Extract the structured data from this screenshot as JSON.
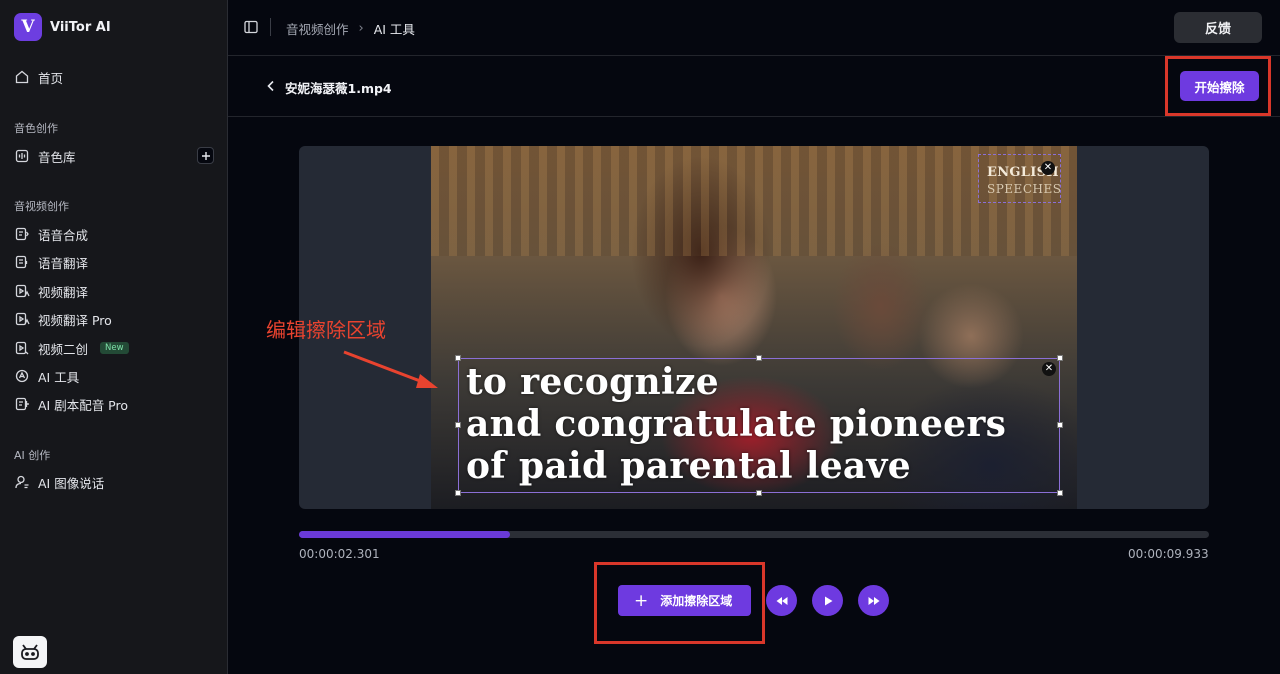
{
  "app": {
    "name": "ViiTor AI",
    "logo_letter": "V"
  },
  "sidebar": {
    "home": "首页",
    "sections": {
      "voice": "音色创作",
      "av": "音视频创作",
      "ai": "AI 创作"
    },
    "voice_items": [
      {
        "label": "音色库",
        "icon": "voice-library-icon"
      }
    ],
    "av_items": [
      {
        "label": "语音合成",
        "icon": "tts-icon"
      },
      {
        "label": "语音翻译",
        "icon": "speech-translate-icon"
      },
      {
        "label": "视频翻译",
        "icon": "video-translate-icon"
      },
      {
        "label": "视频翻译 Pro",
        "icon": "video-translate-pro-icon"
      },
      {
        "label": "视频二创",
        "icon": "video-remix-icon",
        "badge": "New"
      },
      {
        "label": "AI 工具",
        "icon": "ai-tools-icon"
      },
      {
        "label": "AI 剧本配音 Pro",
        "icon": "ai-script-dub-icon"
      }
    ],
    "ai_items": [
      {
        "label": "AI 图像说话",
        "icon": "ai-talking-image-icon"
      }
    ]
  },
  "topbar": {
    "breadcrumb": [
      "音视频创作",
      "AI 工具"
    ],
    "feedback_label": "反馈"
  },
  "file": {
    "name": "安妮海瑟薇1.mp4",
    "start_label": "开始擦除"
  },
  "video": {
    "watermark_line1": "ENGLISH",
    "watermark_line2": "SPEECHES",
    "subtitle_lines": [
      "to recognize",
      "and congratulate pioneers",
      "of paid parental leave"
    ]
  },
  "annotation": {
    "text": "编辑擦除区域"
  },
  "playback": {
    "current_time": "00:00:02.301",
    "total_time": "00:00:09.933",
    "progress_fraction": 0.232
  },
  "controls": {
    "add_region_label": "添加擦除区域"
  },
  "colors": {
    "accent": "#6e3ae0",
    "annotation_red": "#d9372a"
  }
}
